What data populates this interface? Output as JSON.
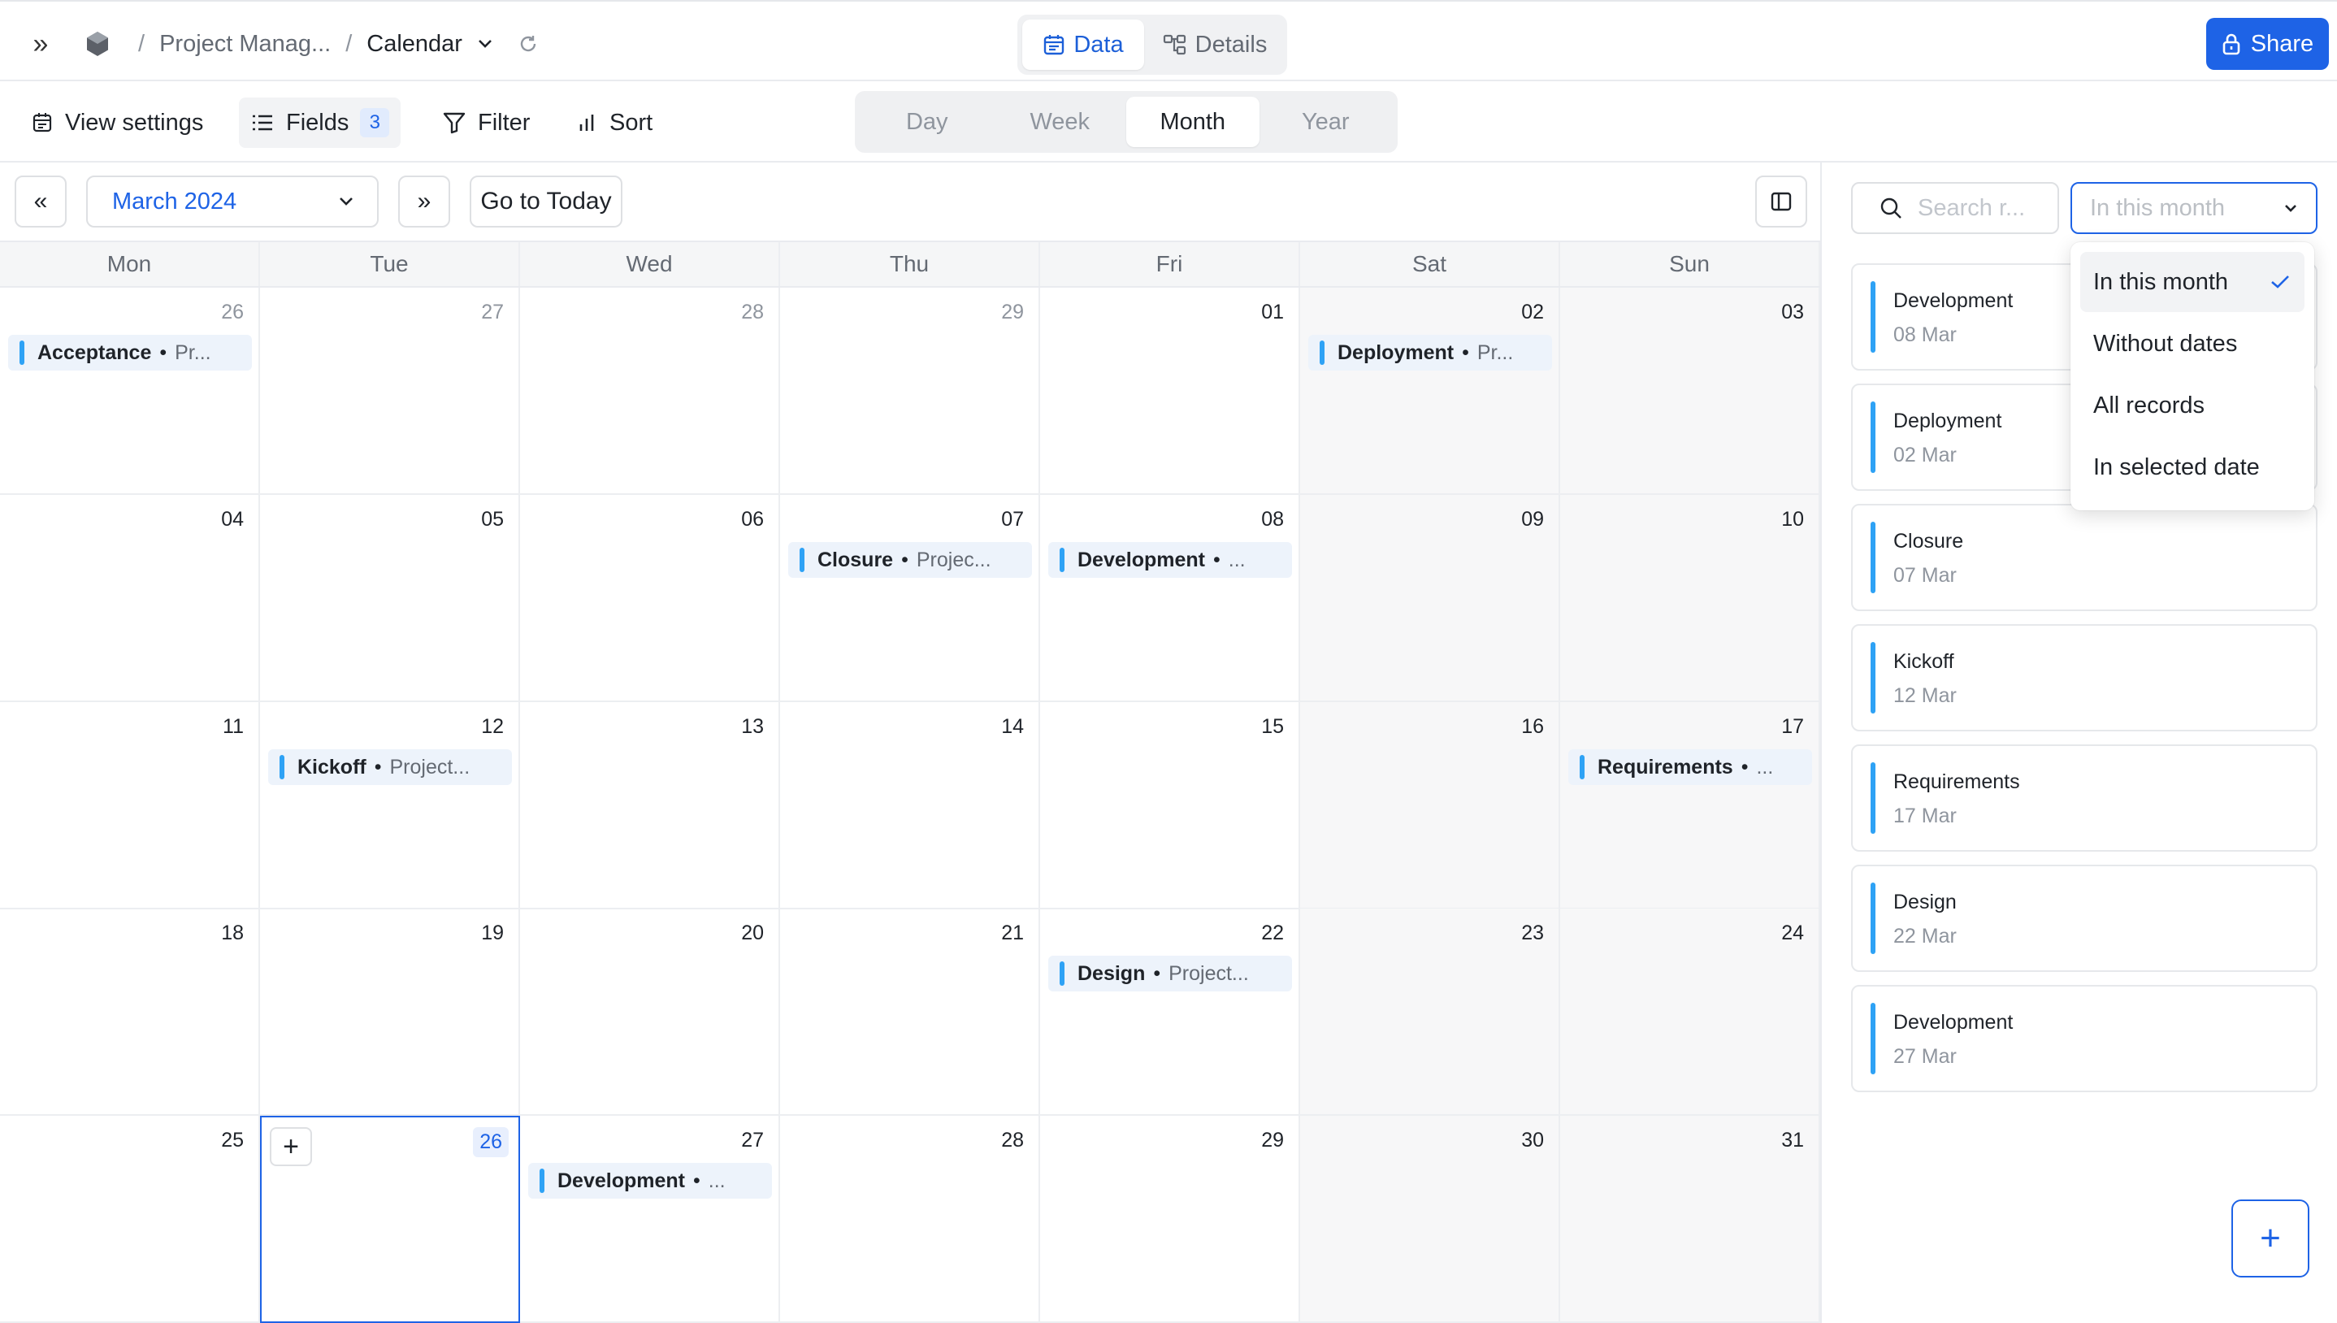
{
  "breadcrumb": {
    "project": "Project Manag...",
    "view": "Calendar",
    "separator": "/"
  },
  "top_tabs": [
    {
      "label": "Data",
      "active": true,
      "icon": "calendar-icon"
    },
    {
      "label": "Details",
      "active": false,
      "icon": "flow-icon"
    }
  ],
  "share": {
    "label": "Share",
    "icon": "lock-icon"
  },
  "toolbar": {
    "view_settings": "View settings",
    "fields": "Fields",
    "fields_count": "3",
    "filter": "Filter",
    "sort": "Sort"
  },
  "view_modes": [
    {
      "label": "Day",
      "active": false
    },
    {
      "label": "Week",
      "active": false
    },
    {
      "label": "Month",
      "active": true
    },
    {
      "label": "Year",
      "active": false
    }
  ],
  "calendar_nav": {
    "prev_icon": "«",
    "month": "March 2024",
    "next_icon": "»",
    "today_label": "Go to Today"
  },
  "weekdays": [
    "Mon",
    "Tue",
    "Wed",
    "Thu",
    "Fri",
    "Sat",
    "Sun"
  ],
  "weeks": [
    [
      "26",
      "27",
      "28",
      "29",
      "01",
      "02",
      "03"
    ],
    [
      "04",
      "05",
      "06",
      "07",
      "08",
      "09",
      "10"
    ],
    [
      "11",
      "12",
      "13",
      "14",
      "15",
      "16",
      "17"
    ],
    [
      "18",
      "19",
      "20",
      "21",
      "22",
      "23",
      "24"
    ],
    [
      "25",
      "26",
      "27",
      "28",
      "29",
      "30",
      "31"
    ]
  ],
  "events": [
    {
      "week": 0,
      "day": 0,
      "title": "Acceptance",
      "project": "Pr..."
    },
    {
      "week": 0,
      "day": 5,
      "title": "Deployment",
      "project": "Pr..."
    },
    {
      "week": 1,
      "day": 3,
      "title": "Closure",
      "project": "Projec..."
    },
    {
      "week": 1,
      "day": 4,
      "title": "Development",
      "project": "..."
    },
    {
      "week": 2,
      "day": 1,
      "title": "Kickoff",
      "project": "Project..."
    },
    {
      "week": 2,
      "day": 6,
      "title": "Requirements",
      "project": "..."
    },
    {
      "week": 3,
      "day": 4,
      "title": "Design",
      "project": "Project..."
    },
    {
      "week": 4,
      "day": 2,
      "title": "Development",
      "project": "..."
    }
  ],
  "today": {
    "week": 4,
    "day": 1
  },
  "side_panel": {
    "search_placeholder": "Search r...",
    "scope_selected": "In this month",
    "records": [
      {
        "name": "Development",
        "date": "08 Mar"
      },
      {
        "name": "Deployment",
        "date": "02 Mar"
      },
      {
        "name": "Closure",
        "date": "07 Mar"
      },
      {
        "name": "Kickoff",
        "date": "12 Mar"
      },
      {
        "name": "Requirements",
        "date": "17 Mar"
      },
      {
        "name": "Design",
        "date": "22 Mar"
      },
      {
        "name": "Development",
        "date": "27 Mar"
      }
    ],
    "add_label": "+"
  },
  "scope_dropdown": {
    "options": [
      "In this month",
      "Without dates",
      "All records",
      "In selected date"
    ],
    "selected_index": 0
  },
  "colors": {
    "accent": "#1e63e6",
    "event_bar": "#2ea2f5",
    "event_bg": "#edf3fb"
  }
}
